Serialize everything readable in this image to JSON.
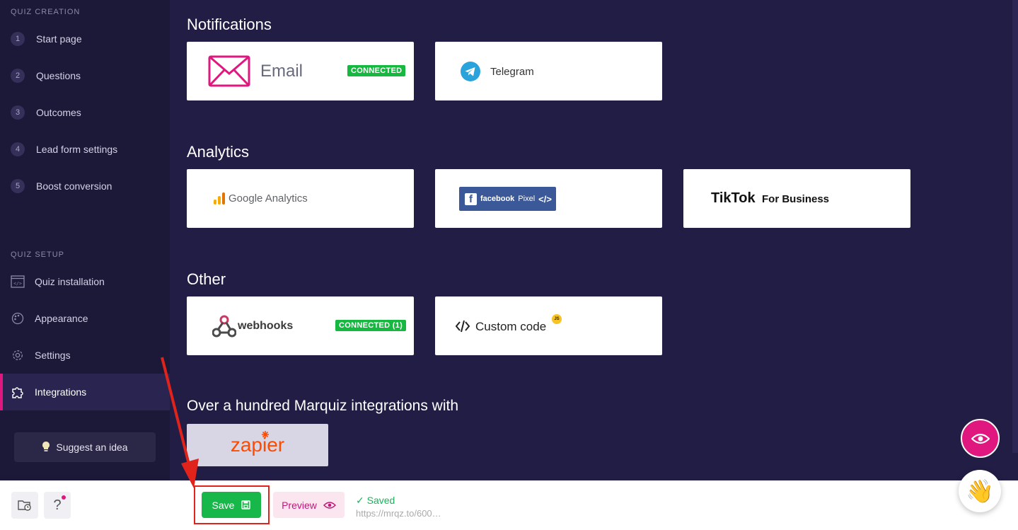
{
  "sidebar": {
    "creation_title": "QUIZ CREATION",
    "steps": [
      {
        "num": "1",
        "label": "Start page"
      },
      {
        "num": "2",
        "label": "Questions"
      },
      {
        "num": "3",
        "label": "Outcomes"
      },
      {
        "num": "4",
        "label": "Lead form settings"
      },
      {
        "num": "5",
        "label": "Boost conversion"
      }
    ],
    "setup_title": "QUIZ SETUP",
    "setup_items": [
      {
        "label": "Quiz installation",
        "icon": "code-window-icon"
      },
      {
        "label": "Appearance",
        "icon": "palette-icon"
      },
      {
        "label": "Settings",
        "icon": "gear-icon"
      },
      {
        "label": "Integrations",
        "icon": "puzzle-icon",
        "active": true
      }
    ],
    "suggest_label": "Suggest an idea"
  },
  "main": {
    "notifications": {
      "heading": "Notifications",
      "email_label": "Email",
      "email_badge": "CONNECTED",
      "telegram_label": "Telegram"
    },
    "analytics": {
      "heading": "Analytics",
      "google_label": "Google Analytics",
      "facebook_label": "facebook",
      "facebook_sub": "Pixel",
      "facebook_code": "</>",
      "tiktok_label": "TikTok",
      "tiktok_sub": "For Business"
    },
    "other": {
      "heading": "Other",
      "webhooks_label": "webhooks",
      "webhooks_badge": "CONNECTED (1)",
      "custom_code_label": "Custom code",
      "custom_code_badge": "JS"
    },
    "marquiz": {
      "heading": "Over a hundred Marquiz integrations with",
      "zapier_label": "zapier"
    }
  },
  "bottom_bar": {
    "help_label": "?",
    "save_label": "Save",
    "preview_label": "Preview",
    "saved_status": "Saved",
    "saved_url": "https://mrqz.to/600…"
  },
  "colors": {
    "accent": "#e0177e",
    "connected": "#16b83f",
    "save": "#18b74a",
    "background": "#221d45",
    "sidebar": "#1b1838"
  }
}
